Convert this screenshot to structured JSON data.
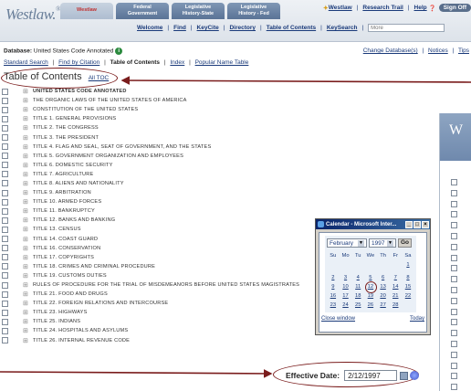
{
  "header": {
    "logo": "Westlaw.",
    "tabs": [
      {
        "label": "Westlaw",
        "active": true
      },
      {
        "label": "Federal\nGovernment",
        "active": false
      },
      {
        "label": "Legislative\nHistory-State",
        "active": false
      },
      {
        "label": "Legislative\nHistory - Fed",
        "active": false
      }
    ],
    "toplinks": [
      "Westlaw",
      "Research Trail",
      "Help",
      "Sign Off"
    ],
    "subnav": [
      "Welcome",
      "Find",
      "KeyCite",
      "Directory",
      "Table of Contents",
      "KeySearch"
    ],
    "search_placeholder": "More"
  },
  "database": {
    "label": "Database:",
    "name": "United States Code Annotated",
    "links": [
      "Change Database(s)",
      "Notices",
      "Tips"
    ]
  },
  "searchlinks": {
    "standard": "Standard Search",
    "find": "Find by Citation",
    "current": "Table of Contents",
    "index": "Index",
    "popular": "Popular Name Table"
  },
  "toc": {
    "title": "Table of Contents",
    "all_toc": "All TOC",
    "items": [
      {
        "text": "UNITED STATES CODE ANNOTATED",
        "bold": true
      },
      {
        "text": "THE ORGANIC LAWS OF THE UNITED STATES OF AMERICA",
        "bold": false
      },
      {
        "text": "CONSTITUTION OF THE UNITED STATES",
        "bold": false
      },
      {
        "text": "TITLE 1. GENERAL PROVISIONS",
        "bold": false
      },
      {
        "text": "TITLE 2. THE CONGRESS",
        "bold": false
      },
      {
        "text": "TITLE 3. THE PRESIDENT",
        "bold": false
      },
      {
        "text": "TITLE 4. FLAG AND SEAL, SEAT OF GOVERNMENT, AND THE STATES",
        "bold": false
      },
      {
        "text": "TITLE 5. GOVERNMENT ORGANIZATION AND EMPLOYEES",
        "bold": false
      },
      {
        "text": "TITLE 6. DOMESTIC SECURITY",
        "bold": false
      },
      {
        "text": "TITLE 7. AGRICULTURE",
        "bold": false
      },
      {
        "text": "TITLE 8. ALIENS AND NATIONALITY",
        "bold": false
      },
      {
        "text": "TITLE 9. ARBITRATION",
        "bold": false
      },
      {
        "text": "TITLE 10. ARMED FORCES",
        "bold": false
      },
      {
        "text": "TITLE 11. BANKRUPTCY",
        "bold": false
      },
      {
        "text": "TITLE 12. BANKS AND BANKING",
        "bold": false
      },
      {
        "text": "TITLE 13. CENSUS",
        "bold": false
      },
      {
        "text": "TITLE 14. COAST GUARD",
        "bold": false
      },
      {
        "text": "TITLE 16. CONSERVATION",
        "bold": false
      },
      {
        "text": "TITLE 17. COPYRIGHTS",
        "bold": false
      },
      {
        "text": "TITLE 18. CRIMES AND CRIMINAL PROCEDURE",
        "bold": false
      },
      {
        "text": "TITLE 19. CUSTOMS DUTIES",
        "bold": false
      },
      {
        "text": "RULES OF PROCEDURE FOR THE TRIAL OF MISDEMEANORS BEFORE UNITED STATES MAGISTRATES",
        "bold": false
      },
      {
        "text": "TITLE 21. FOOD AND DRUGS",
        "bold": false
      },
      {
        "text": "TITLE 22. FOREIGN RELATIONS AND INTERCOURSE",
        "bold": false
      },
      {
        "text": "TITLE 23. HIGHWAYS",
        "bold": false
      },
      {
        "text": "TITLE 25. INDIANS",
        "bold": false
      },
      {
        "text": "TITLE 24. HOSPITALS AND ASYLUMS",
        "bold": false
      },
      {
        "text": "TITLE 26. INTERNAL REVENUE CODE",
        "bold": false
      }
    ]
  },
  "window2": {
    "title": "W"
  },
  "calendar": {
    "window_title": "Calendar - Microsoft Inter...",
    "month": "February",
    "year": "1997",
    "go": "Go",
    "weekdays": [
      "Su",
      "Mo",
      "Tu",
      "We",
      "Th",
      "Fr",
      "Sa"
    ],
    "weeks": [
      [
        "",
        "",
        "",
        "",
        "",
        "",
        "1"
      ],
      [
        "2",
        "3",
        "4",
        "5",
        "6",
        "7",
        "8"
      ],
      [
        "9",
        "10",
        "11",
        "12",
        "13",
        "14",
        "15"
      ],
      [
        "16",
        "17",
        "18",
        "19",
        "20",
        "21",
        "22"
      ],
      [
        "23",
        "24",
        "25",
        "26",
        "27",
        "28",
        ""
      ]
    ],
    "selected_day": "12",
    "close": "Close window",
    "today": "Today"
  },
  "effective_date": {
    "label": "Effective Date:",
    "value": "2/12/1997"
  },
  "colors": {
    "accent": "#7a1c1c",
    "link": "#1a3a7a",
    "tab": "#5a7396"
  }
}
